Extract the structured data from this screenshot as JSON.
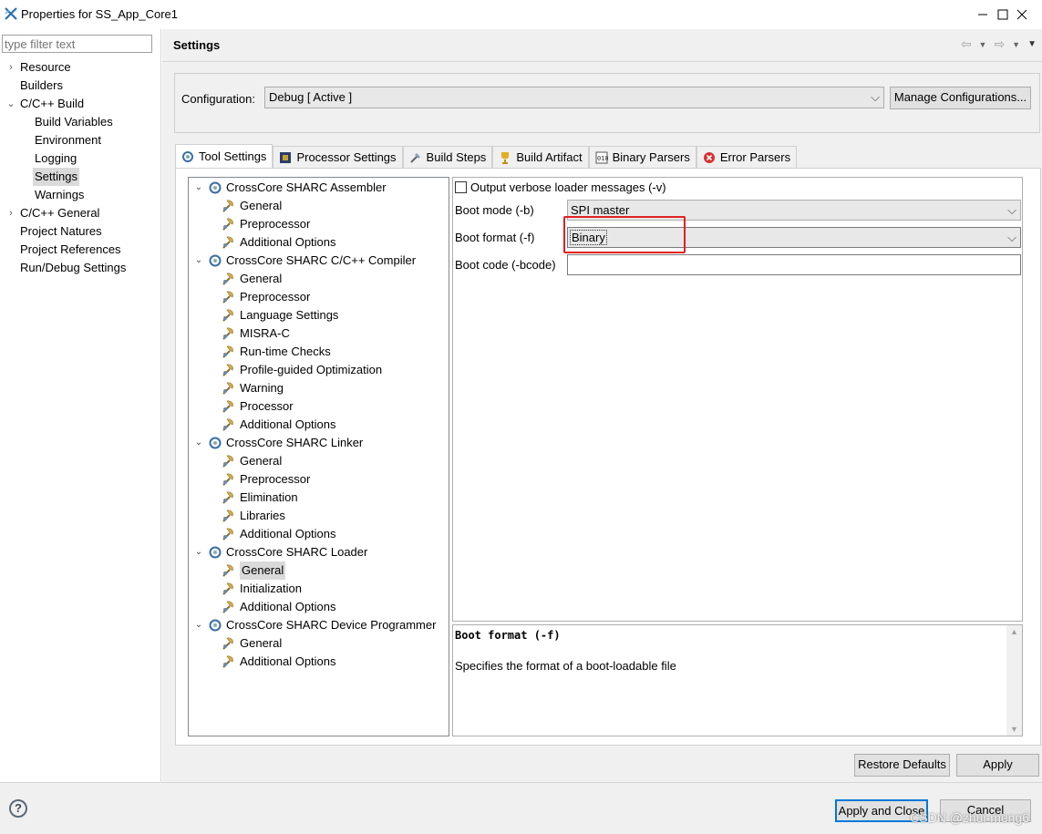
{
  "window": {
    "title": "Properties for SS_App_Core1"
  },
  "filter": {
    "placeholder": "type filter text"
  },
  "nav": {
    "items": [
      {
        "label": "Resource",
        "level": 0,
        "arrow": "›"
      },
      {
        "label": "Builders",
        "level": 0,
        "arrow": ""
      },
      {
        "label": "C/C++ Build",
        "level": 0,
        "arrow": "⌄"
      },
      {
        "label": "Build Variables",
        "level": 1,
        "arrow": ""
      },
      {
        "label": "Environment",
        "level": 1,
        "arrow": ""
      },
      {
        "label": "Logging",
        "level": 1,
        "arrow": ""
      },
      {
        "label": "Settings",
        "level": 1,
        "arrow": "",
        "selected": true
      },
      {
        "label": "Warnings",
        "level": 1,
        "arrow": ""
      },
      {
        "label": "C/C++ General",
        "level": 0,
        "arrow": "›"
      },
      {
        "label": "Project Natures",
        "level": 0,
        "arrow": ""
      },
      {
        "label": "Project References",
        "level": 0,
        "arrow": ""
      },
      {
        "label": "Run/Debug Settings",
        "level": 0,
        "arrow": ""
      }
    ]
  },
  "page": {
    "title": "Settings"
  },
  "configuration": {
    "label": "Configuration:",
    "value": "Debug  [ Active ]",
    "manage_label": "Manage Configurations..."
  },
  "tabs": [
    {
      "label": "Tool Settings",
      "icon": "tool-settings-icon",
      "active": true
    },
    {
      "label": "Processor Settings",
      "icon": "processor-icon"
    },
    {
      "label": "Build Steps",
      "icon": "build-steps-icon"
    },
    {
      "label": "Build Artifact",
      "icon": "trophy-icon"
    },
    {
      "label": "Binary Parsers",
      "icon": "binary-icon"
    },
    {
      "label": "Error Parsers",
      "icon": "error-icon"
    }
  ],
  "tree": [
    {
      "label": "CrossCore SHARC Assembler",
      "type": "tool"
    },
    {
      "label": "General",
      "type": "option"
    },
    {
      "label": "Preprocessor",
      "type": "option"
    },
    {
      "label": "Additional Options",
      "type": "option"
    },
    {
      "label": "CrossCore SHARC C/C++ Compiler",
      "type": "tool"
    },
    {
      "label": "General",
      "type": "option"
    },
    {
      "label": "Preprocessor",
      "type": "option"
    },
    {
      "label": "Language Settings",
      "type": "option"
    },
    {
      "label": "MISRA-C",
      "type": "option"
    },
    {
      "label": "Run-time Checks",
      "type": "option"
    },
    {
      "label": "Profile-guided Optimization",
      "type": "option"
    },
    {
      "label": "Warning",
      "type": "option"
    },
    {
      "label": "Processor",
      "type": "option"
    },
    {
      "label": "Additional Options",
      "type": "option"
    },
    {
      "label": "CrossCore SHARC Linker",
      "type": "tool"
    },
    {
      "label": "General",
      "type": "option"
    },
    {
      "label": "Preprocessor",
      "type": "option"
    },
    {
      "label": "Elimination",
      "type": "option"
    },
    {
      "label": "Libraries",
      "type": "option"
    },
    {
      "label": "Additional Options",
      "type": "option"
    },
    {
      "label": "CrossCore SHARC Loader",
      "type": "tool"
    },
    {
      "label": "General",
      "type": "option",
      "selected": true
    },
    {
      "label": "Initialization",
      "type": "option"
    },
    {
      "label": "Additional Options",
      "type": "option"
    },
    {
      "label": "CrossCore SHARC Device Programmer",
      "type": "tool"
    },
    {
      "label": "General",
      "type": "option"
    },
    {
      "label": "Additional Options",
      "type": "option"
    }
  ],
  "options": {
    "verbose_label": "Output verbose loader messages (-v)",
    "verbose_checked": false,
    "boot_mode_label": "Boot mode (-b)",
    "boot_mode_value": "SPI master",
    "boot_format_label": "Boot format (-f)",
    "boot_format_value": "Binary",
    "boot_code_label": "Boot code (-bcode)",
    "boot_code_value": ""
  },
  "description": {
    "title": "Boot format (-f)",
    "text": "Specifies the format of a boot-loadable file"
  },
  "buttons": {
    "restore_defaults": "Restore Defaults",
    "apply": "Apply",
    "apply_and_close": "Apply and Close",
    "cancel": "Cancel"
  },
  "watermark": "CSDN @zhui-meng6",
  "colors": {
    "highlight": "#e02020",
    "selection": "#dadada",
    "panel": "#f0f0f0"
  }
}
